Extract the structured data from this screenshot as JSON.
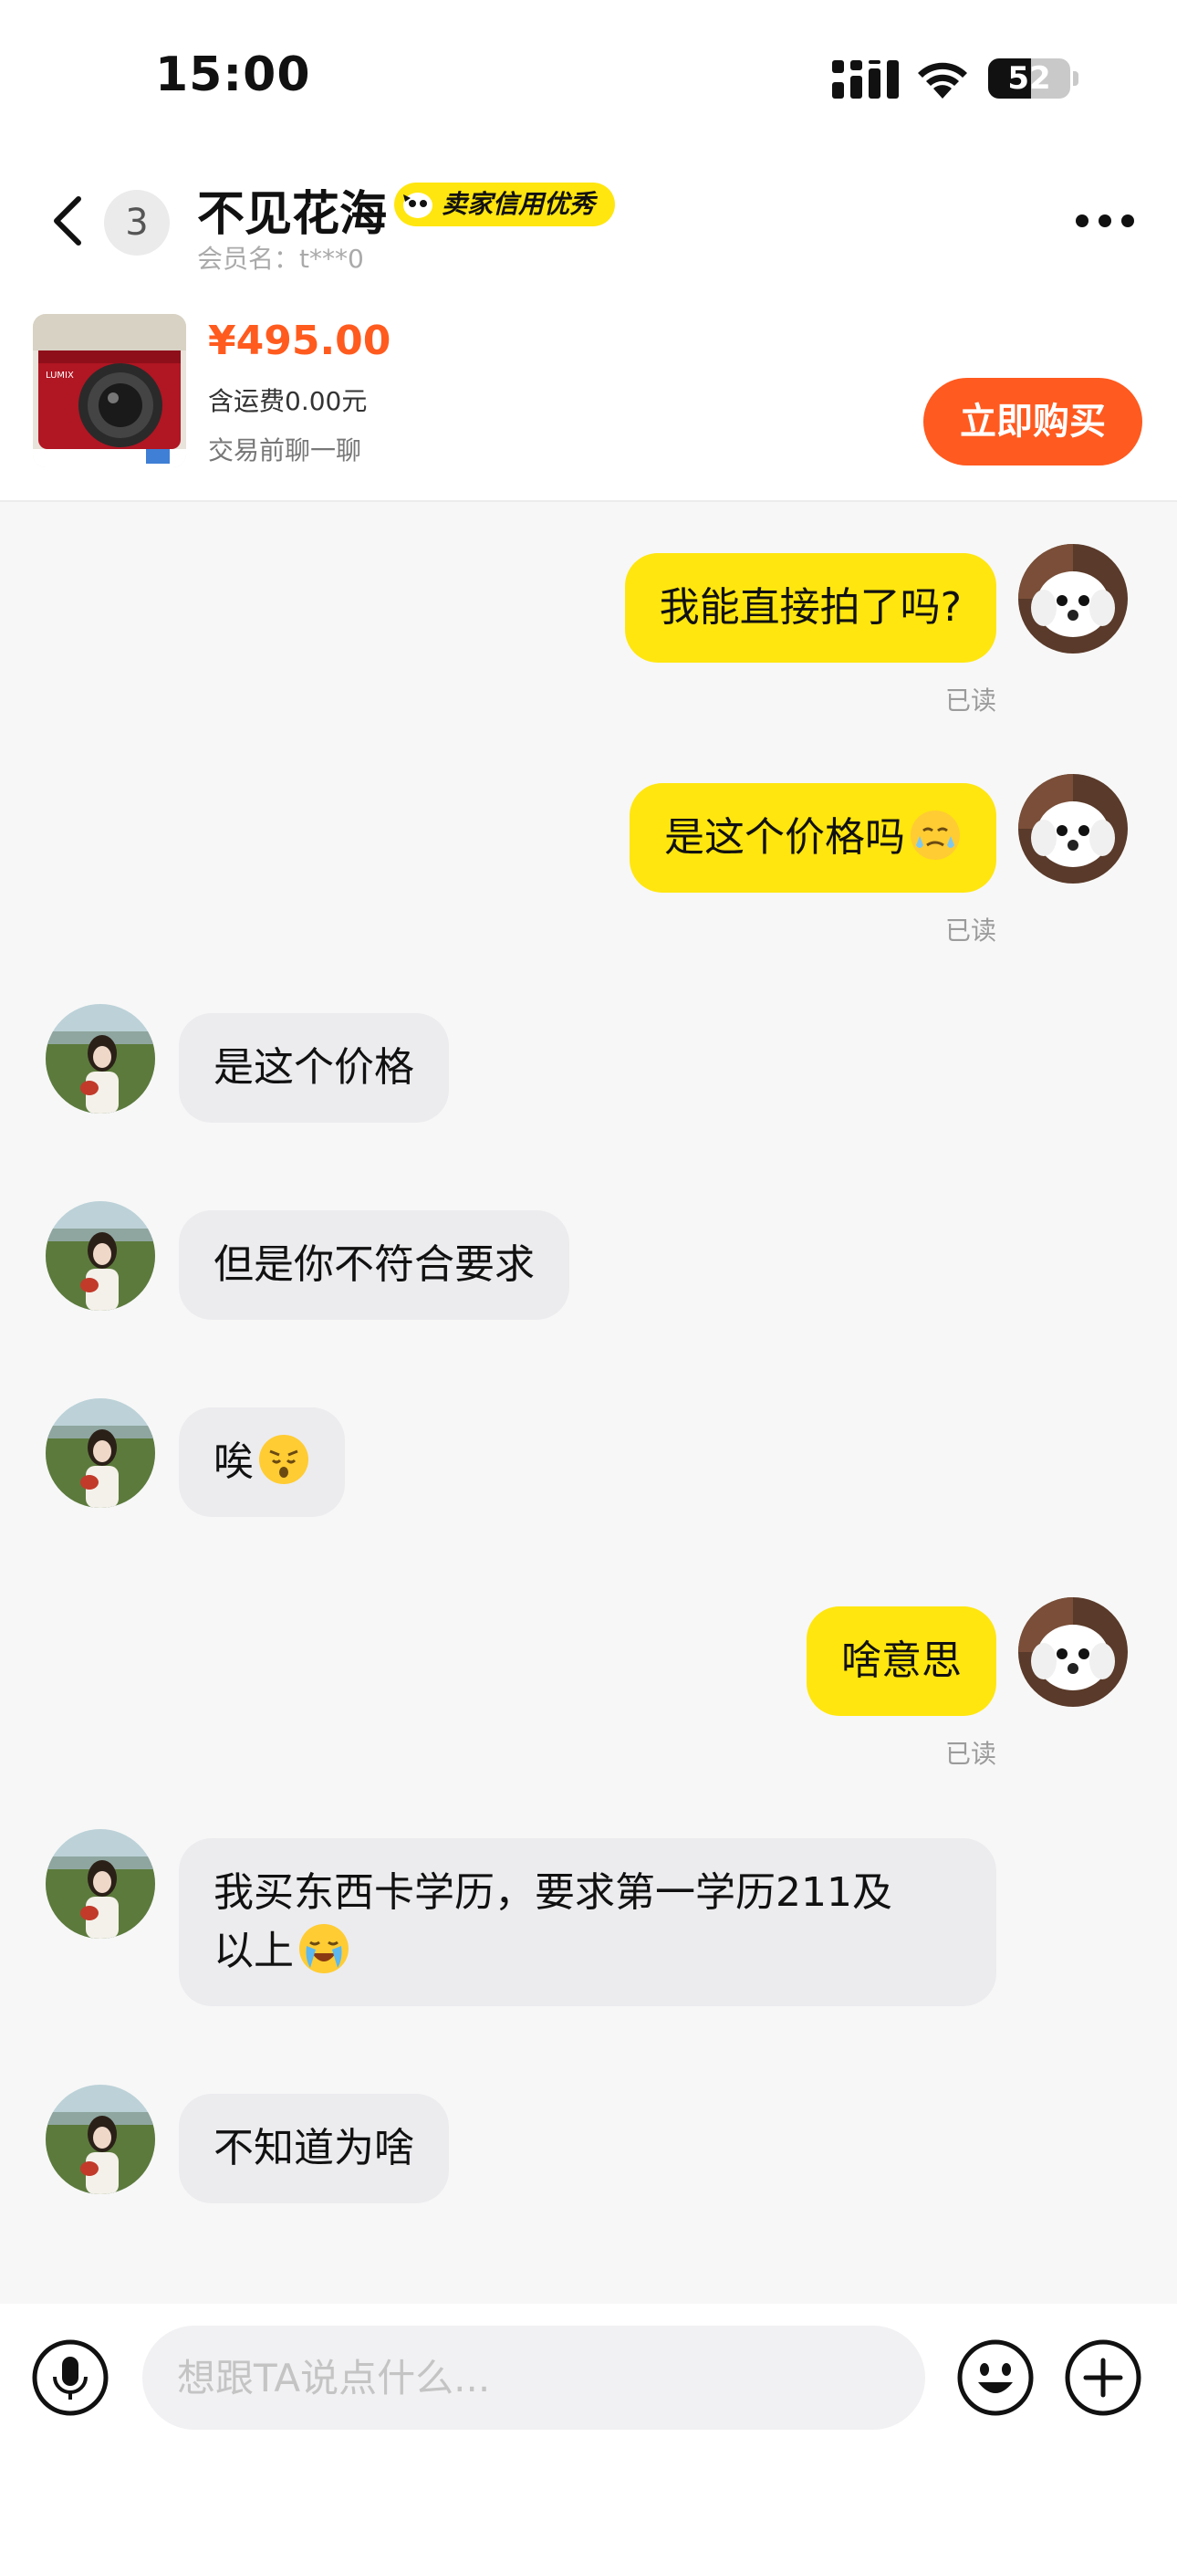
{
  "status_bar": {
    "time": "15:00",
    "battery": "52",
    "battery_level": 0.52
  },
  "header": {
    "unread_count": "3",
    "seller_name": "不见花海",
    "credit_badge": "卖家信用优秀",
    "member_name": "会员名：t***0"
  },
  "product": {
    "price": "¥495.00",
    "shipping": "含运费0.00元",
    "note": "交易前聊一聊",
    "buy_label": "立即购买",
    "thumb_brand": "LUMIX"
  },
  "messages": [
    {
      "from": "me",
      "text": "我能直接拍了吗?",
      "read": "已读"
    },
    {
      "from": "me",
      "text": "是这个价格吗",
      "emoji": "sweat-face-icon",
      "read": "已读"
    },
    {
      "from": "them",
      "text": "是这个价格"
    },
    {
      "from": "them",
      "text": "但是你不符合要求"
    },
    {
      "from": "them",
      "text": "唉",
      "emoji": "worried-face-icon"
    },
    {
      "from": "me",
      "text": "啥意思",
      "read": "已读"
    },
    {
      "from": "them",
      "text_line1": "我买东西卡学历，要求第一学历211及",
      "text_line2": "以上",
      "emoji": "crying-face-icon"
    },
    {
      "from": "them",
      "text": "不知道为啥"
    }
  ],
  "input": {
    "placeholder": "想跟TA说点什么..."
  },
  "colors": {
    "accent_yellow": "#ffe60f",
    "buy_orange": "#ff5a1f",
    "price_orange": "#ff5b1f"
  }
}
